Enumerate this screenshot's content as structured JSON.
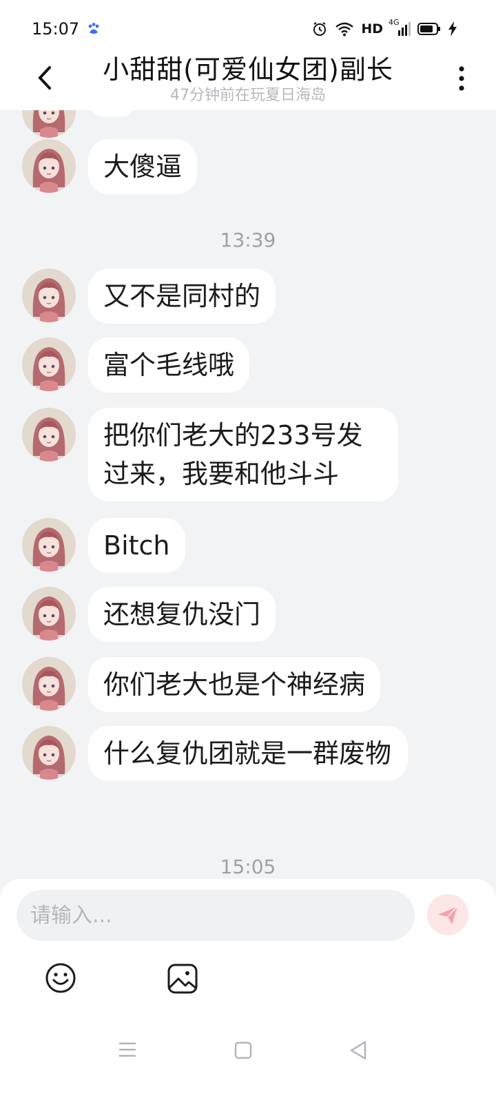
{
  "status_bar": {
    "time": "15:07",
    "hd": "HD",
    "network": "4G"
  },
  "header": {
    "title": "小甜甜(可爱仙女团)副长",
    "subtitle": "47分钟前在玩夏日海岛"
  },
  "messages": [
    {
      "text": "大傻逼"
    },
    {
      "time": "13:39"
    },
    {
      "text": "又不是同村的"
    },
    {
      "text": "富个毛线哦"
    },
    {
      "text": "把你们老大的233号发过来，我要和他斗斗"
    },
    {
      "text": "Bitch"
    },
    {
      "text": "还想复仇没门"
    },
    {
      "text": "你们老大也是个神经病"
    },
    {
      "text": "什么复仇团就是一群废物"
    },
    {
      "time": "15:05"
    }
  ],
  "composer": {
    "placeholder": "请输入..."
  },
  "icons": {
    "back": "chevron-left-icon",
    "more": "more-vertical-icon",
    "send": "send-icon",
    "emoji": "smile-icon",
    "image": "image-icon"
  },
  "colors": {
    "background": "#f2f3f5",
    "bubble": "#ffffff",
    "send_button": "#fde6e6",
    "send_arrow": "#f3a2a8"
  }
}
